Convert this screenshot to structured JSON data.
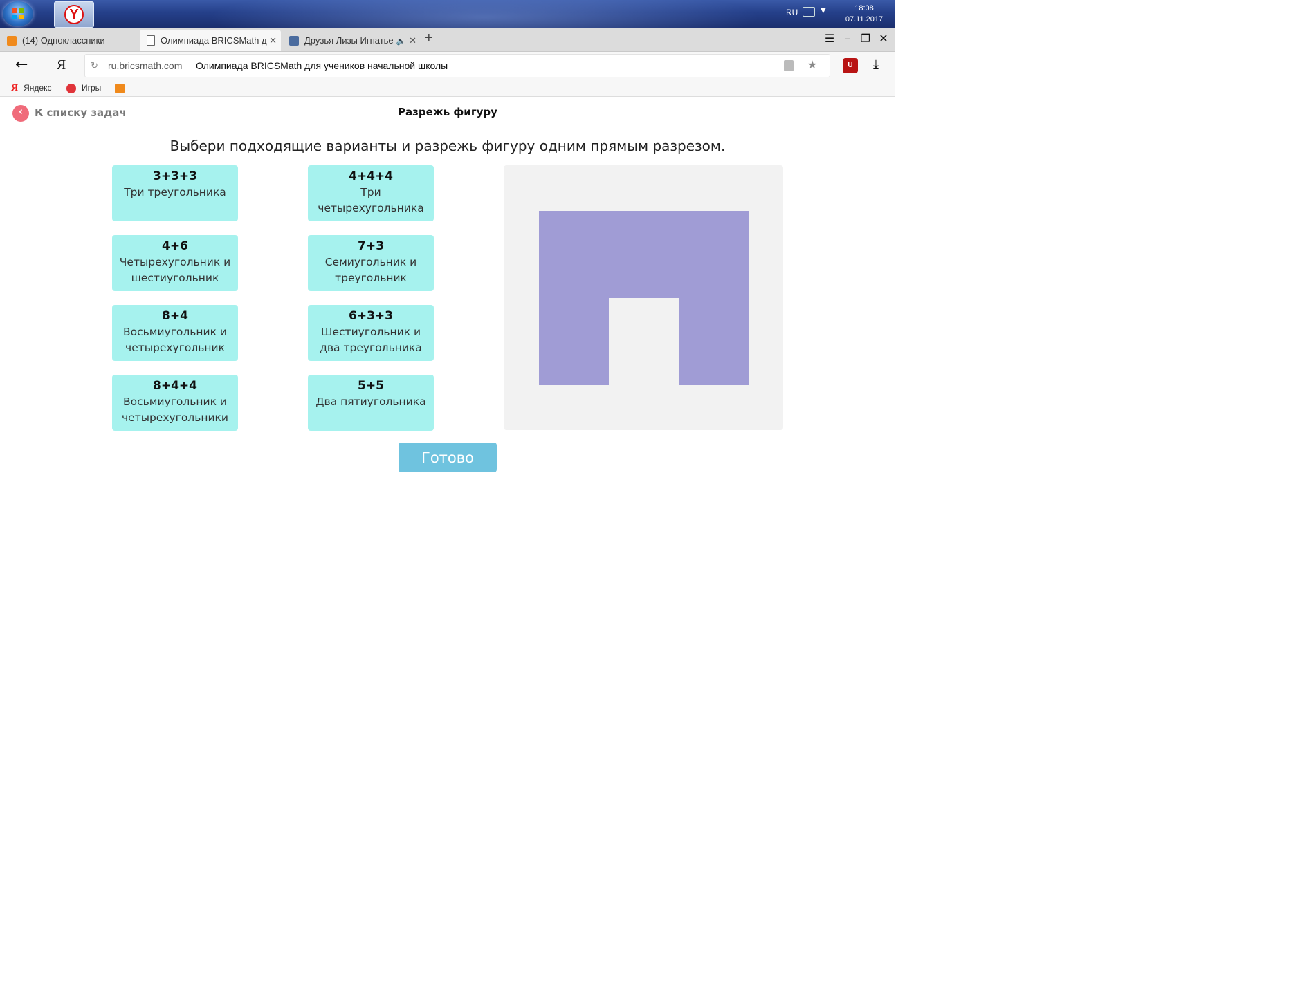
{
  "taskbar": {
    "lang": "RU",
    "time": "18:08",
    "date": "07.11.2017",
    "yandex_letter": "Y"
  },
  "tabs": [
    {
      "label": "(14) Одноклассники"
    },
    {
      "label": "Олимпиада BRICSMath д"
    },
    {
      "label": "Друзья Лизы Игнатье"
    }
  ],
  "address": {
    "ya_letter": "Я",
    "domain": "ru.bricsmath.com",
    "title": "Олимпиада BRICSMath для учеников начальной школы"
  },
  "bookmarks": [
    {
      "label": "Яндекс"
    },
    {
      "label": "Игры"
    }
  ],
  "page": {
    "back_label": "К списку задач",
    "title": "Разрежь фигуру",
    "instruction": "Выбери подходящие варианты и разрежь фигуру одним прямым разрезом.",
    "done_label": "Готово"
  },
  "options": [
    {
      "formula": "3+3+3",
      "desc": "Три треугольника"
    },
    {
      "formula": "4+4+4",
      "desc": "Три четырехугольника"
    },
    {
      "formula": "4+6",
      "desc": "Четырехугольник и шестиугольник"
    },
    {
      "formula": "7+3",
      "desc": "Семиугольник и треугольник"
    },
    {
      "formula": "8+4",
      "desc": "Восьмиугольник и четырехугольник"
    },
    {
      "formula": "6+3+3",
      "desc": "Шестиугольник и два треугольника"
    },
    {
      "formula": "8+4+4",
      "desc": "Восьмиугольник и четырехугольники"
    },
    {
      "formula": "5+5",
      "desc": "Два пятиугольника"
    }
  ],
  "colors": {
    "option_bg": "#a6f2ee",
    "figure_fill": "#a09cd5",
    "figure_panel": "#f2f2f2",
    "done_bg": "#6fc3df",
    "back_circle": "#f06b7a"
  }
}
